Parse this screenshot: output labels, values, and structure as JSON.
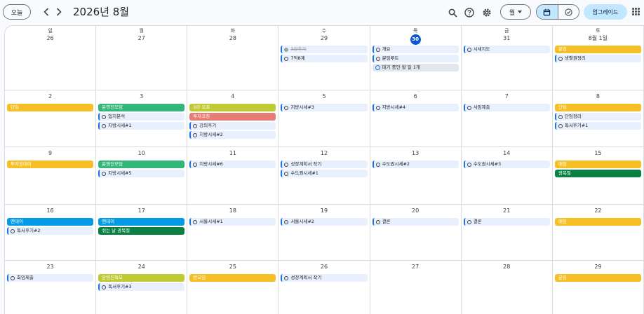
{
  "header": {
    "today_label": "오늘",
    "month_title": "2026년 8월",
    "view_label": "월",
    "upgrade_label": "업그레이드"
  },
  "weekdays": [
    "일",
    "월",
    "화",
    "수",
    "목",
    "금",
    "토"
  ],
  "colors": {
    "yellow": "#f6bf26",
    "green": "#33b679",
    "olive": "#c0ca33",
    "red": "#e67c73",
    "blue": "#039be5",
    "darkgreen": "#0b8043",
    "task_bg": "#e8f0fe",
    "today": "#0b57d0"
  },
  "weeks": [
    [
      {
        "day": "26",
        "events": []
      },
      {
        "day": "27",
        "events": []
      },
      {
        "day": "28",
        "events": []
      },
      {
        "day": "29",
        "events": [
          {
            "kind": "task",
            "title": "3장추가",
            "done": true
          },
          {
            "kind": "task",
            "title": "7억8계"
          }
        ]
      },
      {
        "day": "30",
        "today": true,
        "events": [
          {
            "kind": "task",
            "title": "개요"
          },
          {
            "kind": "task",
            "title": "분임루트"
          },
          {
            "kind": "pending",
            "title": "대기 중인 할 일 1개"
          }
        ]
      },
      {
        "day": "31",
        "events": [
          {
            "kind": "task",
            "title": "시세지도"
          }
        ]
      },
      {
        "day": "8월 1일",
        "events": [
          {
            "kind": "solid",
            "color": "yellow",
            "title": "분임"
          },
          {
            "kind": "task",
            "title": "생활권정리"
          }
        ]
      }
    ],
    [
      {
        "day": "2",
        "events": [
          {
            "kind": "solid",
            "color": "yellow",
            "title": "단임"
          }
        ]
      },
      {
        "day": "3",
        "events": [
          {
            "kind": "solid",
            "color": "green",
            "title": "운영진모임"
          },
          {
            "kind": "task",
            "title": "입지분석"
          },
          {
            "kind": "task",
            "title": "지방시세#1"
          }
        ]
      },
      {
        "day": "4",
        "events": [
          {
            "kind": "solid",
            "color": "olive",
            "title": "3강 오프"
          },
          {
            "kind": "solid",
            "color": "red",
            "title": "투자코칭"
          },
          {
            "kind": "task",
            "title": "강의후기"
          },
          {
            "kind": "task",
            "title": "지방시세#2"
          }
        ]
      },
      {
        "day": "5",
        "events": [
          {
            "kind": "task",
            "title": "지방시세#3"
          }
        ]
      },
      {
        "day": "6",
        "events": [
          {
            "kind": "task",
            "title": "지방시세#4"
          }
        ]
      },
      {
        "day": "7",
        "events": [
          {
            "kind": "task",
            "title": "사임제출"
          }
        ]
      },
      {
        "day": "8",
        "events": [
          {
            "kind": "solid",
            "color": "yellow",
            "title": "단임"
          },
          {
            "kind": "task",
            "title": "단임정리"
          },
          {
            "kind": "task",
            "title": "독서후기#1"
          }
        ]
      }
    ],
    [
      {
        "day": "9",
        "events": [
          {
            "kind": "solid",
            "color": "yellow",
            "title": "투자원데이"
          }
        ]
      },
      {
        "day": "10",
        "events": [
          {
            "kind": "solid",
            "color": "green",
            "title": "운영진모임"
          },
          {
            "kind": "task",
            "title": "지방시세#5"
          }
        ]
      },
      {
        "day": "11",
        "events": [
          {
            "kind": "task",
            "title": "지방시세#6"
          }
        ]
      },
      {
        "day": "12",
        "events": [
          {
            "kind": "task",
            "title": "성장계획서 작기"
          },
          {
            "kind": "task",
            "title": "수도권시세#1"
          }
        ]
      },
      {
        "day": "13",
        "events": [
          {
            "kind": "task",
            "title": "수도권시세#2"
          }
        ]
      },
      {
        "day": "14",
        "events": [
          {
            "kind": "task",
            "title": "수도권시세#3"
          }
        ]
      },
      {
        "day": "15",
        "events": [
          {
            "kind": "solid",
            "color": "yellow",
            "title": "매임"
          },
          {
            "kind": "solid",
            "color": "darkgreen",
            "title": "광복절"
          }
        ]
      }
    ],
    [
      {
        "day": "16",
        "events": [
          {
            "kind": "solid",
            "color": "blue",
            "title": "멘데이"
          },
          {
            "kind": "task",
            "title": "독서후기#2"
          }
        ]
      },
      {
        "day": "17",
        "events": [
          {
            "kind": "solid",
            "color": "blue",
            "title": "멘데이"
          },
          {
            "kind": "solid",
            "color": "darkgreen",
            "title": "쉬는 날 광복절"
          }
        ]
      },
      {
        "day": "18",
        "events": [
          {
            "kind": "task",
            "title": "서울시세#1"
          }
        ]
      },
      {
        "day": "19",
        "events": [
          {
            "kind": "task",
            "title": "서울시세#2"
          }
        ]
      },
      {
        "day": "20",
        "events": [
          {
            "kind": "task",
            "title": "결론"
          }
        ]
      },
      {
        "day": "21",
        "events": [
          {
            "kind": "task",
            "title": "결론"
          }
        ]
      },
      {
        "day": "22",
        "events": [
          {
            "kind": "solid",
            "color": "yellow",
            "title": "매임"
          }
        ]
      }
    ],
    [
      {
        "day": "23",
        "events": [
          {
            "kind": "task",
            "title": "회임제출"
          }
        ]
      },
      {
        "day": "24",
        "events": [
          {
            "kind": "solid",
            "color": "olive",
            "title": "운영진특모"
          },
          {
            "kind": "task",
            "title": "독서후기#3"
          }
        ]
      },
      {
        "day": "25",
        "events": [
          {
            "kind": "solid",
            "color": "yellow",
            "title": "반모임"
          }
        ]
      },
      {
        "day": "26",
        "events": [
          {
            "kind": "task",
            "title": "성장계획서 작기"
          }
        ]
      },
      {
        "day": "27",
        "events": []
      },
      {
        "day": "28",
        "events": []
      },
      {
        "day": "29",
        "events": [
          {
            "kind": "solid",
            "color": "yellow",
            "title": "분임"
          }
        ]
      }
    ]
  ]
}
